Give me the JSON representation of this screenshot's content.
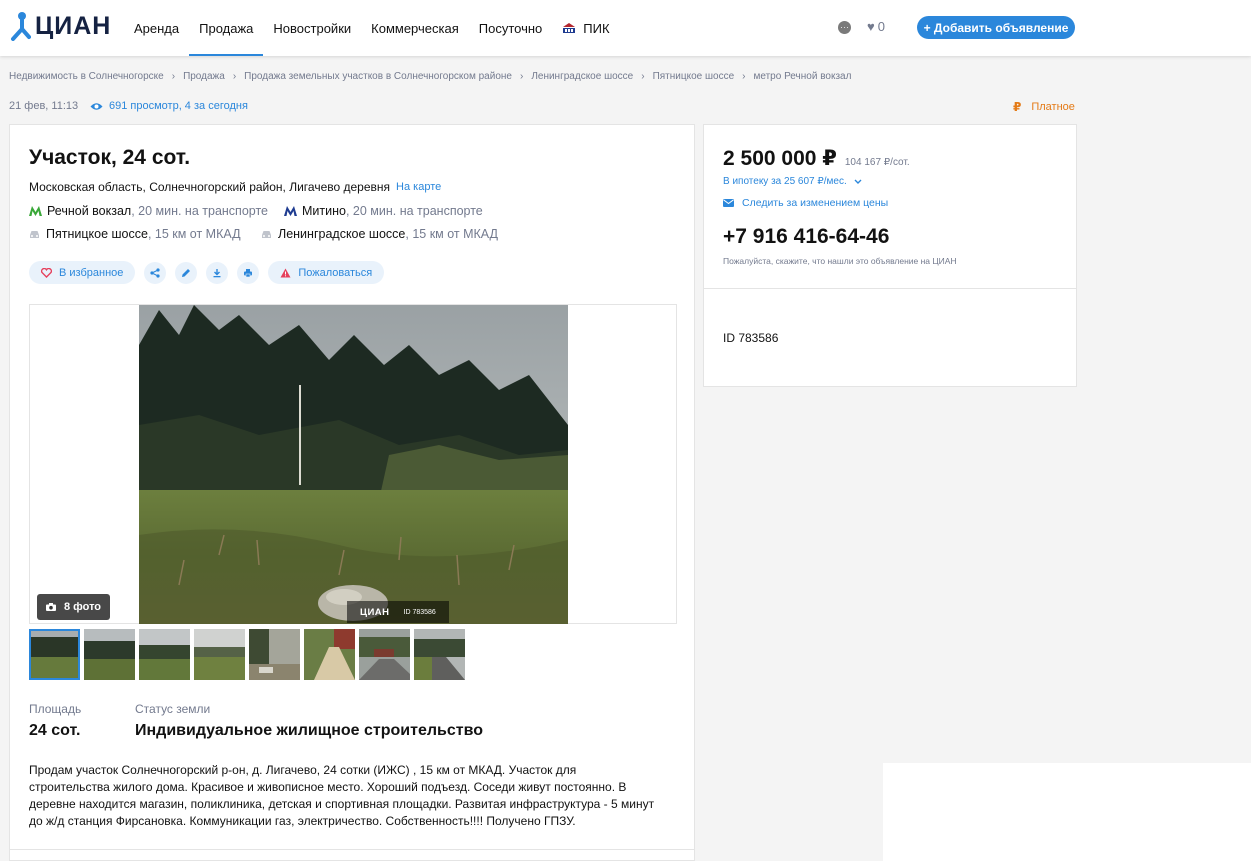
{
  "header": {
    "logo_text": "ЦИАН",
    "nav": [
      "Аренда",
      "Продажа",
      "Новостройки",
      "Коммерческая",
      "Посуточно",
      "ПИК"
    ],
    "favorites_count": "0",
    "add_button": "+ Добавить объявление"
  },
  "breadcrumbs": [
    "Недвижимость в Солнечногорске",
    "Продажа",
    "Продажа земельных участков в Солнечногорском районе",
    "Ленинградское шоссе",
    "Пятницкое шоссе",
    "метро Речной вокзал"
  ],
  "meta": {
    "date": "21 фев, 11:13",
    "views": "691 просмотр, 4 за сегодня",
    "paid_symbol": "₽",
    "paid_label": "Платное"
  },
  "listing": {
    "title": "Участок, 24 сот.",
    "address": "Московская область, Солнечногорский район, Лигачево деревня",
    "map_link": "На карте",
    "metro": [
      {
        "name": "Речной вокзал",
        "time": ", 20 мин. на транспорте",
        "color": "#3aa839"
      },
      {
        "name": "Митино",
        "time": ", 20 мин. на транспорте",
        "color": "#1f3c91"
      }
    ],
    "roads": [
      {
        "name": "Пятницкое шоссе",
        "dist": ", 15 км от МКАД"
      },
      {
        "name": "Ленинградское шоссе",
        "dist": ", 15 км от МКАД"
      }
    ],
    "actions": {
      "favorite": "В избранное",
      "report": "Пожаловаться"
    },
    "photo_count": "8 фото",
    "watermark_logo": "ЦИАН",
    "watermark_id": "ID 783586",
    "facts": [
      {
        "label": "Площадь",
        "value": "24 сот."
      },
      {
        "label": "Статус земли",
        "value": "Индивидуальное жилищное строительство"
      }
    ],
    "description": "Продам участок Солнечногорский р-он, д. Лигачево, 24 сотки (ИЖС) , 15 км от МКАД. Участок для строительства жилого дома. Красивое и живописное место. Хороший подъезд. Соседи живут постоянно. В деревне находится магазин, поликлиника, детская и спортивная площадки. Развитая инфраструктура - 5 минут до ж/д станция Фирсановка. Коммуникации газ, электричество. Собственность!!!! Получено ГПЗУ."
  },
  "side": {
    "price": "2 500 000 ₽",
    "price_per": "104 167 ₽/сот.",
    "mortgage": "В ипотеку за 25 607 ₽/мес.",
    "follow": "Следить за изменением цены",
    "phone": "+7 916 416-64-46",
    "phone_note": "Пожалуйста, скажите, что нашли это объявление на ЦИАН",
    "id": "ID 783586"
  },
  "colors": {
    "accent": "#2b87db",
    "paid": "#e47a16",
    "muted": "#737a8e"
  }
}
